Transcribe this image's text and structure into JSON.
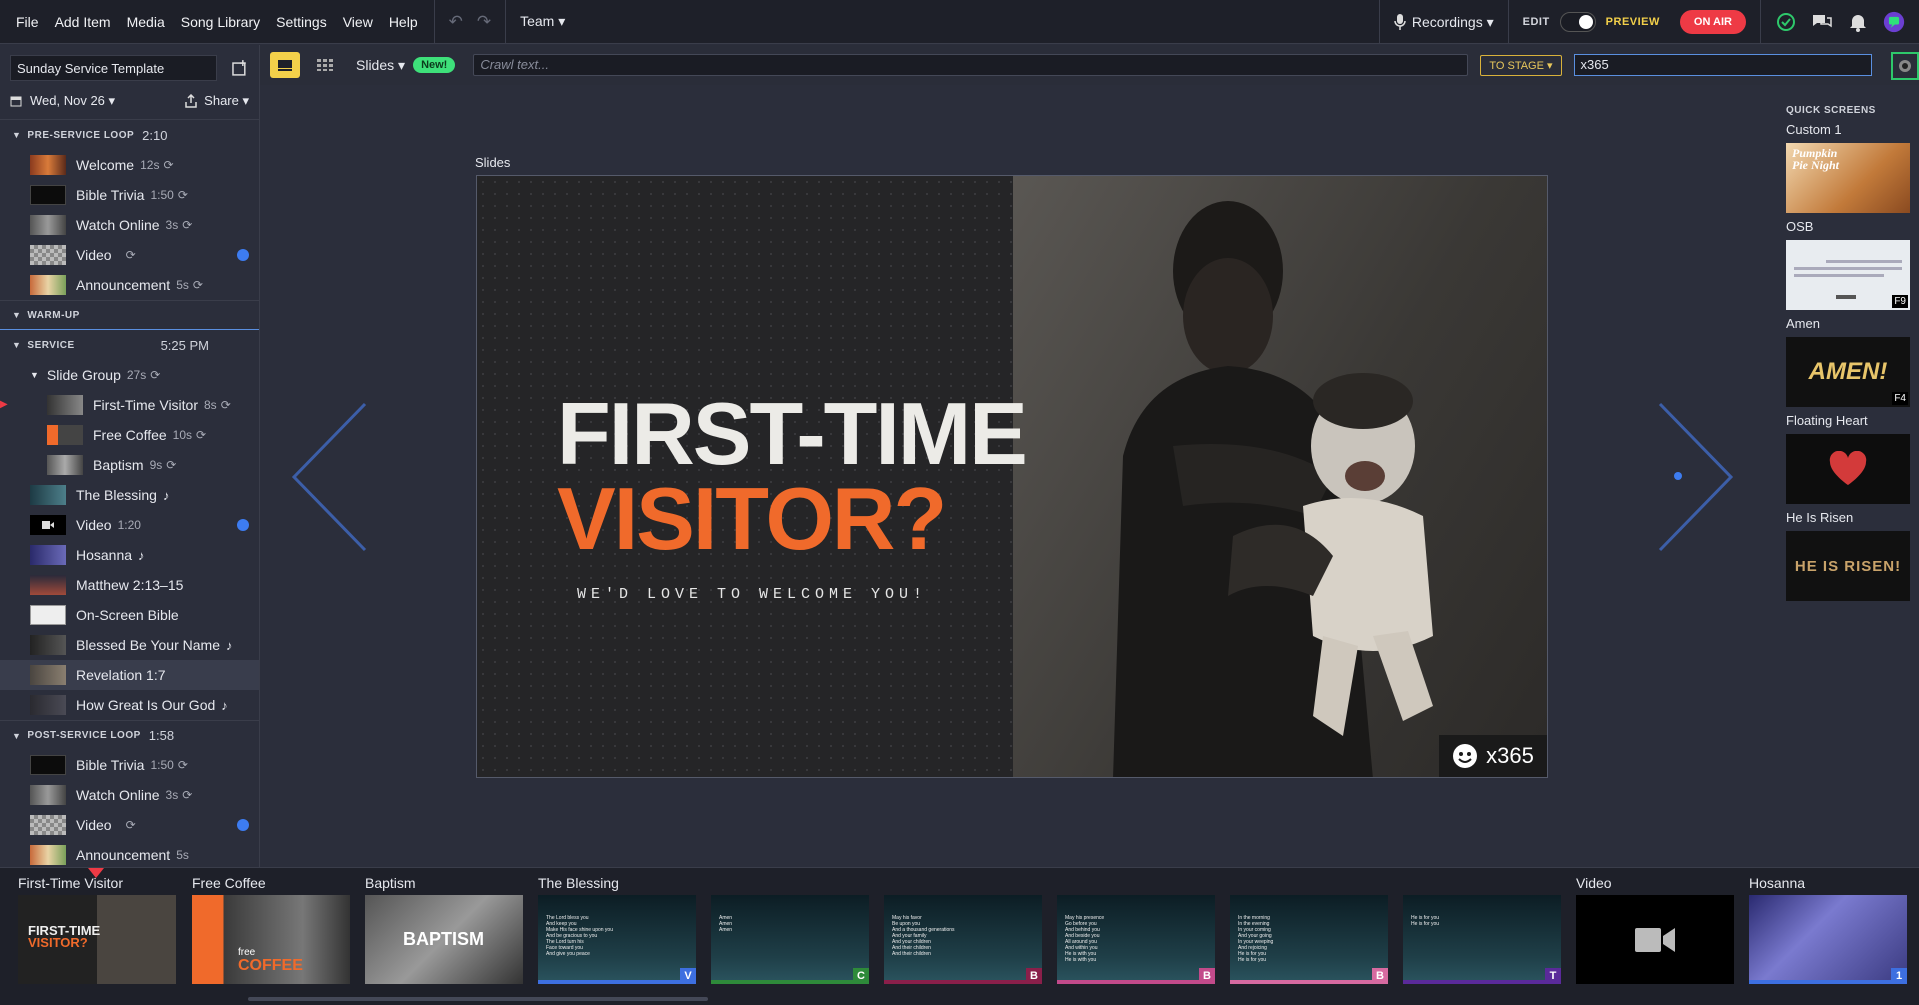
{
  "menu": [
    "File",
    "Add Item",
    "Media",
    "Song Library",
    "Settings",
    "View",
    "Help"
  ],
  "team": "Team ▾",
  "recordings": "Recordings ▾",
  "edit_label": "EDIT",
  "preview_label": "PREVIEW",
  "on_air": "ON AIR",
  "template_name": "Sunday Service Template",
  "date": "Wed, Nov 26 ▾",
  "share": "Share ▾",
  "slides_dd": "Slides ▾",
  "new_badge": "New!",
  "crawl_placeholder": "Crawl text...",
  "to_stage": "TO STAGE ▾",
  "stage_value": "x365",
  "stage_title": "Slides",
  "slide": {
    "line1": "FIRST-TIME",
    "line2": "VISITOR?",
    "line3": "WE'D LOVE TO WELCOME YOU!",
    "badge": "x365"
  },
  "sections": [
    {
      "name": "PRE-SERVICE LOOP",
      "dur": "2:10"
    },
    {
      "name": "WARM-UP",
      "dur": ""
    },
    {
      "name": "SERVICE",
      "dur": "5:25 PM"
    },
    {
      "name": "POST-SERVICE LOOP",
      "dur": "1:58"
    }
  ],
  "pre_items": [
    {
      "label": "Welcome",
      "meta": "12s"
    },
    {
      "label": "Bible Trivia",
      "meta": "1:50"
    },
    {
      "label": "Watch Online",
      "meta": "3s"
    },
    {
      "label": "Video",
      "meta": ""
    },
    {
      "label": "Announcement",
      "meta": "5s"
    }
  ],
  "service_items": [
    {
      "label": "Slide Group",
      "meta": "27s"
    },
    {
      "label": "First-Time Visitor",
      "meta": "8s"
    },
    {
      "label": "Free Coffee",
      "meta": "10s"
    },
    {
      "label": "Baptism",
      "meta": "9s"
    },
    {
      "label": "The Blessing",
      "meta": ""
    },
    {
      "label": "Video",
      "meta": "1:20"
    },
    {
      "label": "Hosanna",
      "meta": ""
    },
    {
      "label": "Matthew 2:13–15",
      "meta": ""
    },
    {
      "label": "On-Screen Bible",
      "meta": ""
    },
    {
      "label": "Blessed Be Your Name",
      "meta": ""
    },
    {
      "label": "Revelation 1:7",
      "meta": ""
    },
    {
      "label": "How Great Is Our God",
      "meta": ""
    }
  ],
  "post_items": [
    {
      "label": "Bible Trivia",
      "meta": "1:50"
    },
    {
      "label": "Watch Online",
      "meta": "3s"
    },
    {
      "label": "Video",
      "meta": ""
    },
    {
      "label": "Announcement",
      "meta": "5s"
    }
  ],
  "quick": {
    "title": "QUICK SCREENS",
    "items": [
      {
        "label": "Custom 1",
        "text": "Pumpkin Pie Night",
        "key": ""
      },
      {
        "label": "OSB",
        "text": "",
        "key": "F9"
      },
      {
        "label": "Amen",
        "text": "AMEN!",
        "key": "F4"
      },
      {
        "label": "Floating Heart",
        "text": "",
        "key": ""
      },
      {
        "label": "He Is Risen",
        "text": "HE IS RISEN!",
        "key": ""
      }
    ]
  },
  "strip": {
    "labels": [
      "First-Time Visitor",
      "Free Coffee",
      "Baptism",
      "The Blessing",
      "Video",
      "Hosanna"
    ],
    "thumb_text": {
      "ftv1": "FIRST-TIME",
      "ftv2": "VISITOR?",
      "coffee1": "free",
      "coffee2": "COFFEE",
      "baptism": "BAPTISM"
    },
    "blessing_letters": [
      "V",
      "C",
      "B",
      "B",
      "B",
      "T"
    ],
    "hosanna_letter": "1",
    "lyrics": [
      "The Lord bless you\nAnd keep you\nMake His face shine upon you\nAnd be gracious to you\nThe Lord turn his\nFace toward you\nAnd give you peace",
      "Amen\nAmen\nAmen",
      "May his favor\nBe upon you\nAnd a thousand generations\nAnd your family\nAnd your children\nAnd their children\nAnd their children",
      "May his presence\nGo before you\nAnd behind you\nAnd beside you\nAll around you\nAnd within you\nHe is with you\nHe is with you",
      "In the morning\nIn the evening\nIn your coming\nAnd your going\nIn your weeping\nAnd rejoicing\nHe is for you\nHe is for you",
      "He is for you\nHe is for you"
    ]
  }
}
